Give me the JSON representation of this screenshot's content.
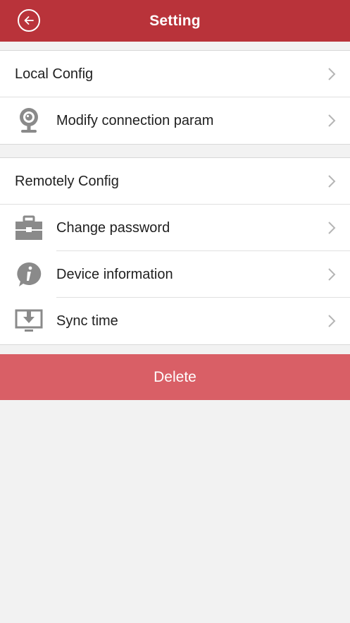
{
  "header": {
    "title": "Setting",
    "back_icon": "back-arrow-circle-icon",
    "background": "#b9333a"
  },
  "local_group": {
    "section_label": "Local Config",
    "items": [
      {
        "label": "Modify connection param",
        "icon": "webcam-icon"
      }
    ]
  },
  "remote_group": {
    "section_label": "Remotely Config",
    "items": [
      {
        "label": "Change password",
        "icon": "toolbox-icon"
      },
      {
        "label": "Device information",
        "icon": "info-bubble-icon"
      },
      {
        "label": "Sync time",
        "icon": "monitor-download-icon"
      }
    ]
  },
  "actions": {
    "delete_label": "Delete",
    "delete_color": "#d95f66"
  }
}
